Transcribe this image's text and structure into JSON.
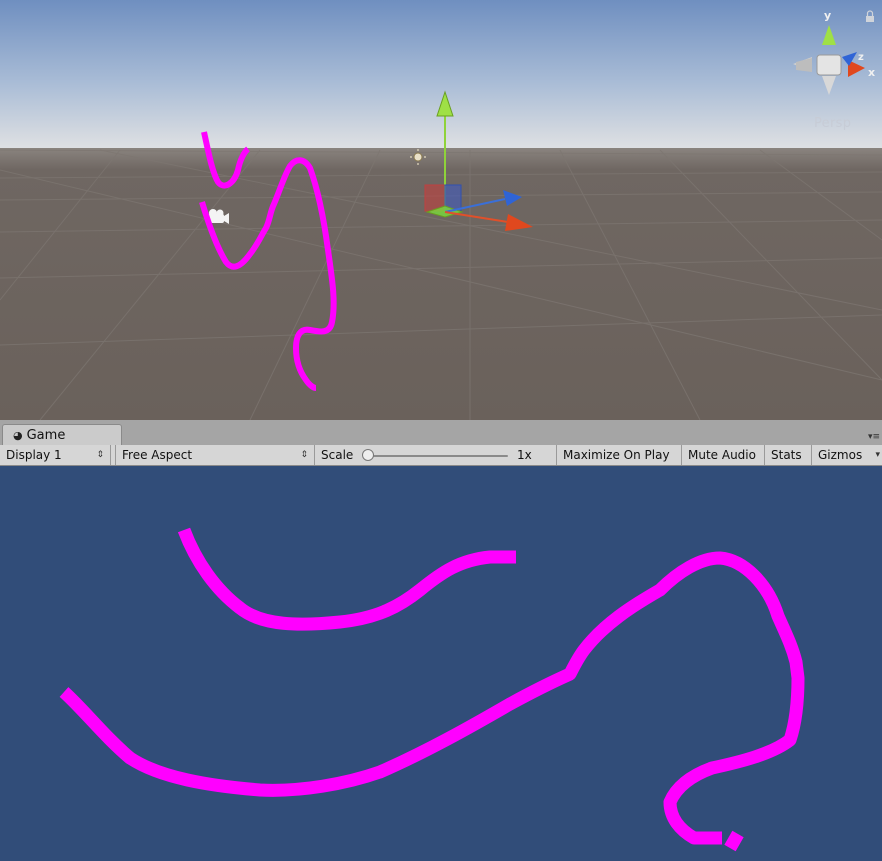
{
  "scene": {
    "view_mode_label": "Persp",
    "gizmo_axis_labels": {
      "y": "y",
      "z": "z",
      "x": "x"
    },
    "colors": {
      "sky_top": "#6f8fc0",
      "horizon": "#d9dde2",
      "ground": "#6b625d",
      "stroke": "#ff00ff"
    }
  },
  "game_tab": {
    "icon": "pacman-icon",
    "label": "Game"
  },
  "toolbar": {
    "display": "Display 1",
    "aspect": "Free Aspect",
    "scale_label": "Scale",
    "scale_value": "1x",
    "maximize_on_play": "Maximize On Play",
    "mute_audio": "Mute Audio",
    "stats": "Stats",
    "gizmos": "Gizmos"
  },
  "game": {
    "colors": {
      "background": "#314d79",
      "stroke": "#ff00ff"
    }
  }
}
